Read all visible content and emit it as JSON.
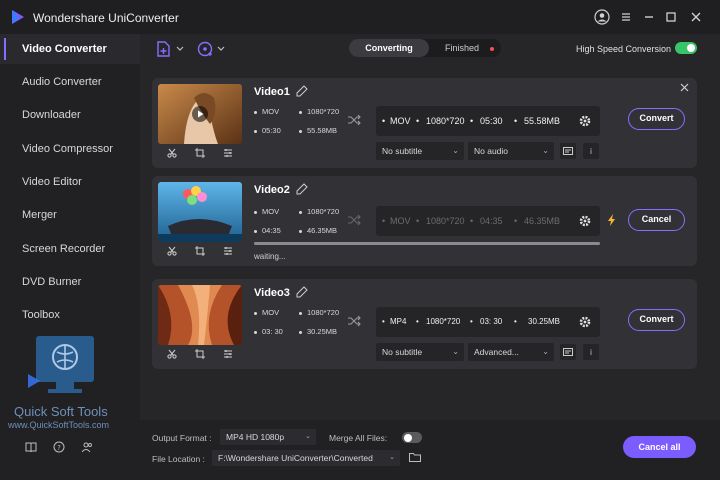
{
  "app": {
    "title": "Wondershare UniConverter"
  },
  "sidebar": {
    "items": [
      {
        "label": "Video Converter"
      },
      {
        "label": "Audio Converter"
      },
      {
        "label": "Downloader"
      },
      {
        "label": "Video Compressor"
      },
      {
        "label": "Video Editor"
      },
      {
        "label": "Merger"
      },
      {
        "label": "Screen Recorder"
      },
      {
        "label": "DVD Burner"
      },
      {
        "label": "Toolbox"
      }
    ]
  },
  "watermark": {
    "brand": "Quick Soft Tools",
    "url": "www.QuickSoftTools.com"
  },
  "toolbar": {
    "tab_converting": "Converting",
    "tab_finished": "Finished",
    "high_speed_label": "High Speed Conversion",
    "high_speed_on": true
  },
  "videos": [
    {
      "name": "Video1",
      "src": {
        "format": "MOV",
        "resolution": "1080*720",
        "duration": "05:30",
        "size": "55.58MB"
      },
      "dst": {
        "format": "MOV",
        "resolution": "1080*720",
        "duration": "05:30",
        "size": "55.58MB"
      },
      "subtitle": "No subtitle",
      "audio": "No audio",
      "action": "Convert"
    },
    {
      "name": "Video2",
      "src": {
        "format": "MOV",
        "resolution": "1080*720",
        "duration": "04:35",
        "size": "46.35MB"
      },
      "dst": {
        "format": "MOV",
        "resolution": "1080*720",
        "duration": "04:35",
        "size": "46.35MB"
      },
      "status": "waiting...",
      "progress": 1.0,
      "action": "Cancel"
    },
    {
      "name": "Video3",
      "src": {
        "format": "MOV",
        "resolution": "1080*720",
        "duration": "03: 30",
        "size": "30.25MB"
      },
      "dst": {
        "format": "MP4",
        "resolution": "1080*720",
        "duration": "03: 30",
        "size": "30.25MB"
      },
      "subtitle": "No subtitle",
      "audio": "Advanced...",
      "action": "Convert"
    }
  ],
  "footer": {
    "output_format_label": "Output Format :",
    "output_format_value": "MP4 HD 1080p",
    "merge_label": "Merge All Files:",
    "merge_on": false,
    "file_location_label": "File Location :",
    "file_location_value": "F:\\Wondershare UniConverter\\Converted",
    "cancel_all": "Cancel all"
  },
  "colors": {
    "accent": "#7b5cff",
    "toggle_on": "#3ac46a",
    "dot": "#ff4d4d"
  }
}
